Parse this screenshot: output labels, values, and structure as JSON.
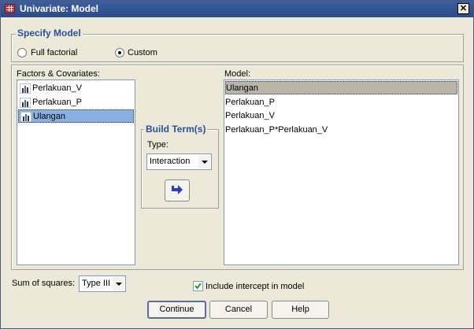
{
  "window": {
    "title": "Univariate: Model",
    "close_glyph": "✕"
  },
  "specify_model": {
    "title": "Specify Model",
    "options": [
      {
        "label": "Full factorial",
        "checked": false
      },
      {
        "label": "Custom",
        "checked": true
      }
    ]
  },
  "factors": {
    "label": "Factors & Covariates:",
    "items": [
      {
        "label": "Perlakuan_V",
        "selected": false
      },
      {
        "label": "Perlakuan_P",
        "selected": false
      },
      {
        "label": "Ulangan",
        "selected": true
      }
    ]
  },
  "build_terms": {
    "title": "Build Term(s)",
    "type_label": "Type:",
    "type_value": "Interaction"
  },
  "model": {
    "label": "Model:",
    "items": [
      {
        "label": "Ulangan",
        "selected": true
      },
      {
        "label": "Perlakuan_P",
        "selected": false
      },
      {
        "label": "Perlakuan_V",
        "selected": false
      },
      {
        "label": "Perlakuan_P*Perlakuan_V",
        "selected": false
      }
    ]
  },
  "sum_of_squares": {
    "label": "Sum of squares:",
    "value": "Type III"
  },
  "intercept": {
    "label": "Include intercept in model",
    "checked": true
  },
  "buttons": {
    "continue": "Continue",
    "cancel": "Cancel",
    "help": "Help"
  },
  "colors": {
    "title_bar": "#2c4a86",
    "group_title": "#2a4fa0",
    "selection": "#8ab0e0",
    "arrow": "#2a3fc0"
  }
}
